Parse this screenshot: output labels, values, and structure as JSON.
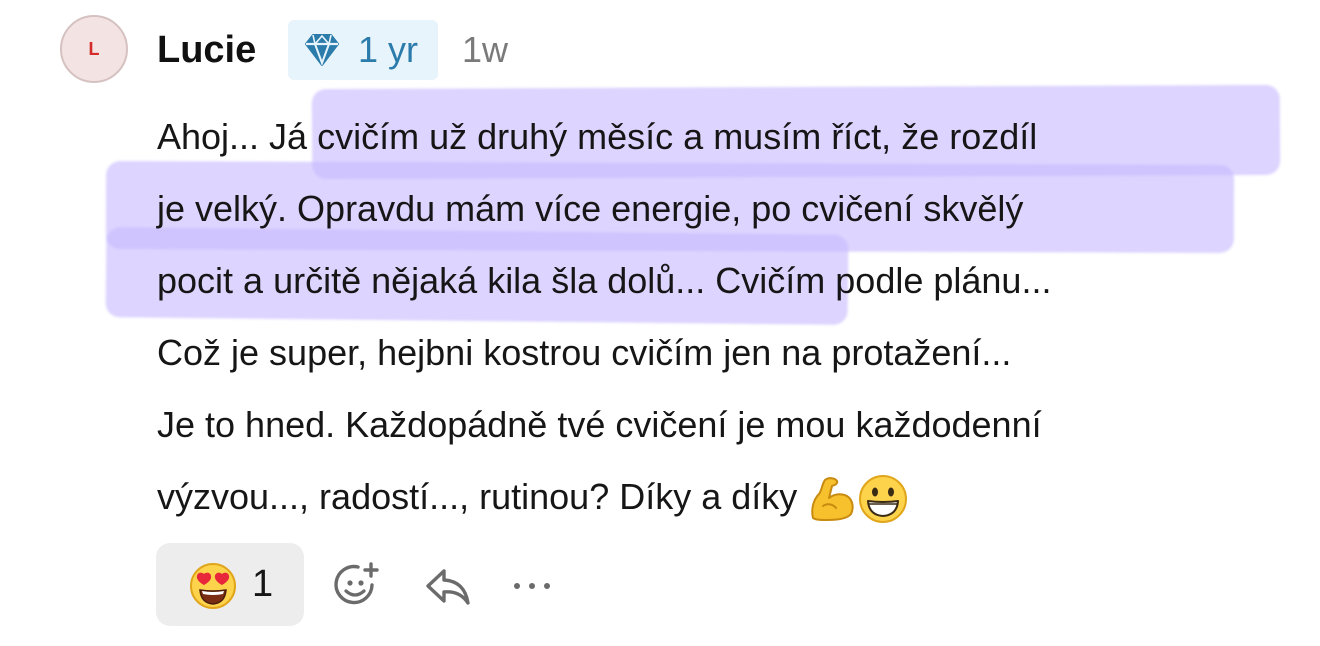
{
  "comment": {
    "author": {
      "initial": "L",
      "name": "Lucie",
      "badge_icon": "diamond-icon",
      "badge_label": "1 yr",
      "time_ago": "1w"
    },
    "body_lines": [
      "Ahoj... Já cvičím už druhý měsíc a musím říct, že rozdíl",
      "je velký. Opravdu mám více energie, po cvičení skvělý",
      "pocit a určitě nějaká kila šla dolů... Cvičím podle plánu...",
      "Což je super, hejbni kostrou cvičím jen na protažení...",
      "Je to hned. Každopádně tvé cvičení je mou každodenní",
      "výzvou..., radostí..., rutinou? Díky a díky"
    ],
    "inline_emojis": [
      "flexed-biceps-emoji",
      "grinning-face-emoji"
    ],
    "reaction": {
      "emoji": "heart-eyes-emoji",
      "count": "1"
    },
    "actions": [
      "add-reaction-icon",
      "reply-icon",
      "more-options-icon"
    ]
  },
  "colors": {
    "badge_bg": "#e8f4fb",
    "badge_text": "#2b7bab",
    "highlight": "#c8b9ff",
    "avatar_bg": "#f4e3e3",
    "avatar_text": "#d42a2a",
    "reaction_bg": "#ededed"
  }
}
